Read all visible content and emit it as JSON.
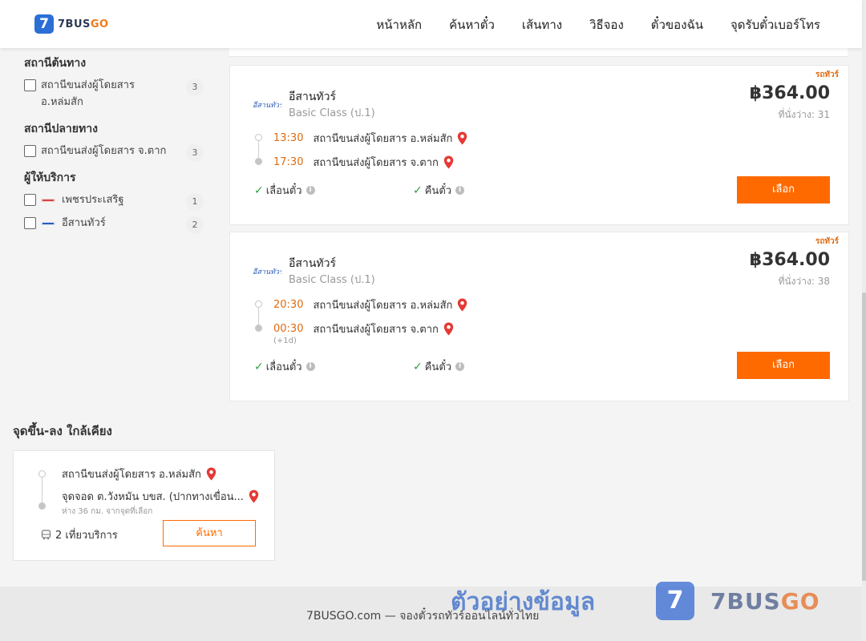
{
  "header": {
    "logo_mark": "7",
    "logo_text_a": "7BUS",
    "logo_text_b": "GO",
    "nav": [
      "หน้าหลัก",
      "ค้นหาตั๋ว",
      "เส้นทาง",
      "วิธีจอง",
      "ตั๋วของฉัน",
      "จุดรับตั๋วเบอร์โทร"
    ]
  },
  "sidebar": {
    "origin": {
      "title": "สถานีต้นทาง",
      "items": [
        {
          "label": "สถานีขนส่งผู้โดยสาร อ.หล่มสัก",
          "count": "3"
        }
      ]
    },
    "destination": {
      "title": "สถานีปลายทาง",
      "items": [
        {
          "label": "สถานีขนส่งผู้โดยสาร จ.ตาก",
          "count": "3"
        }
      ]
    },
    "operator": {
      "title": "ผู้ให้บริการ",
      "items": [
        {
          "label": "เพชรประเสริฐ",
          "count": "1"
        },
        {
          "label": "อีสานทัวร์",
          "count": "2"
        }
      ]
    }
  },
  "trips": [
    {
      "badge": "รถทัวร์",
      "operator": "อีสานทัวร์",
      "bus_class": "Basic Class (ป.1)",
      "price": "฿364.00",
      "seats": "ที่นั่งว่าง: 31",
      "depart_time": "13:30",
      "depart_station": "สถานีขนส่งผู้โดยสาร อ.หล่มสัก",
      "arrive_time": "17:30",
      "arrive_station": "สถานีขนส่งผู้โดยสาร จ.ตาก",
      "policy_change": "เลื่อนตั๋ว",
      "policy_refund": "คืนตั๋ว",
      "select_label": "เลือก"
    },
    {
      "badge": "รถทัวร์",
      "operator": "อีสานทัวร์",
      "bus_class": "Basic Class (ป.1)",
      "price": "฿364.00",
      "seats": "ที่นั่งว่าง: 38",
      "depart_time": "20:30",
      "depart_station": "สถานีขนส่งผู้โดยสาร อ.หล่มสัก",
      "arrive_time": "00:30",
      "arrive_station": "สถานีขนส่งผู้โดยสาร จ.ตาก",
      "arrive_note": "(+1d)",
      "policy_change": "เลื่อนตั๋ว",
      "policy_refund": "คืนตั๋ว",
      "select_label": "เลือก"
    }
  ],
  "nearby": {
    "title": "จุดขึ้น-ลง ใกล้เคียง",
    "stop1": "สถานีขนส่งผู้โดยสาร อ.หล่มสัก",
    "stop2": "จุดจอด ต.วังหมัน บขส. (ปากทางเขื่อน...",
    "distance": "ห่าง 36 กม. จากจุดที่เลือก",
    "trips": "2 เที่ยวบริการ",
    "search_label": "ค้นหา"
  },
  "footer": {
    "text": "7BUSGO.com — จองตั๋วรถทัวร์ออนไลน์ทั่วไทย",
    "watermark": "ตัวอย่างข้อมูล",
    "watermark_mark": "7",
    "watermark_brand_a": "7BUS",
    "watermark_brand_b": "GO"
  },
  "colors": {
    "accent": "#ff6a00",
    "time": "#e06b10",
    "check": "#2e9e3e",
    "pin": "#e53935",
    "brand": "#2b6fd6"
  }
}
